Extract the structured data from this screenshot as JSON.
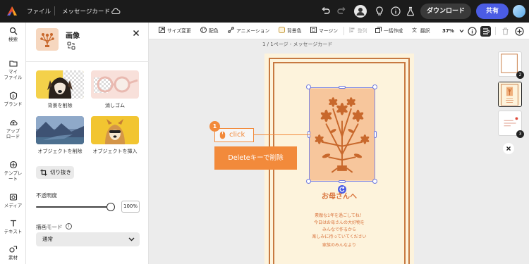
{
  "topbar": {
    "file_label": "ファイル",
    "doc_title": "メッセージカード",
    "download_label": "ダウンロード",
    "share_label": "共有"
  },
  "rail": {
    "items": [
      {
        "label": "検索",
        "icon": "search-icon"
      },
      {
        "label": "マイ\nファイル",
        "icon": "folder-icon"
      },
      {
        "label": "ブランド",
        "icon": "brand-icon"
      },
      {
        "label": "アップ\nロード",
        "icon": "upload-icon"
      },
      {
        "label": "テンプレ\nート",
        "icon": "template-icon"
      },
      {
        "label": "メディア",
        "icon": "media-icon"
      },
      {
        "label": "テキスト",
        "icon": "text-icon"
      },
      {
        "label": "素材",
        "icon": "elements-icon"
      }
    ]
  },
  "panel": {
    "title": "画像",
    "tools": [
      {
        "label": "背景を削除"
      },
      {
        "label": "消しゴム"
      },
      {
        "label": "オブジェクトを削除"
      },
      {
        "label": "オブジェクトを挿入"
      }
    ],
    "crop_label": "切り抜き",
    "opacity_label": "不透明度",
    "opacity_value": "100%",
    "opacity_level": 1.0,
    "blend_label": "描画モード",
    "blend_value": "通常"
  },
  "toolbar": {
    "resize": "サイズ変更",
    "color": "配色",
    "animation": "アニメーション",
    "bg_color": "背景色",
    "margin": "マージン",
    "align": "整列",
    "bulk": "一括作成",
    "translate": "翻訳",
    "zoom": "37%"
  },
  "canvas": {
    "page_label": "1 / 1ページ - メッセージカード",
    "card_title": "お母さんへ",
    "card_lines": [
      "素敵な1年を過ごしてね！",
      "今日はお母さんの大好物を",
      "みんなで作るから",
      "楽しみに待っていてください",
      "家族のみんなより"
    ]
  },
  "annotation": {
    "step_number": "1",
    "click_label": "click",
    "delete_label": "Deleteキーで削除"
  },
  "pages": {
    "badges": [
      "2",
      "3"
    ]
  },
  "colors": {
    "accent": "#4b5ce4",
    "card_bg": "#fdf3dc",
    "card_orange": "#d8713a",
    "annotation_orange": "#f28a3b"
  }
}
